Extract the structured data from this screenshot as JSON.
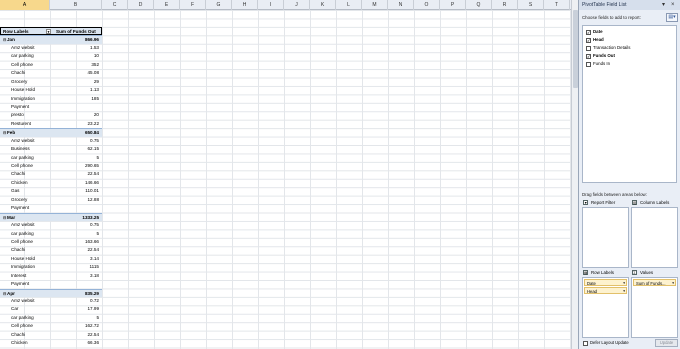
{
  "columns": [
    "A",
    "B",
    "C",
    "D",
    "E",
    "F",
    "G",
    "H",
    "I",
    "J",
    "K",
    "L",
    "M",
    "N",
    "O",
    "P",
    "Q",
    "R",
    "S",
    "T"
  ],
  "pivot": {
    "row_labels_header": "Row Labels",
    "values_header": "Sum of Funds Out",
    "rows": [
      {
        "type": "month",
        "label": "Jan",
        "value": "866.96"
      },
      {
        "type": "item",
        "label": "Amz websit",
        "value": "1.53"
      },
      {
        "type": "item",
        "label": "car parking",
        "value": "10"
      },
      {
        "type": "item",
        "label": "Cell phone",
        "value": "352"
      },
      {
        "type": "item",
        "label": "Chachi",
        "value": "45.08"
      },
      {
        "type": "item",
        "label": "Grocery",
        "value": "29"
      },
      {
        "type": "item",
        "label": "House Hold",
        "value": "1.13"
      },
      {
        "type": "item",
        "label": "Immigration",
        "value": "185"
      },
      {
        "type": "item",
        "label": "Payment",
        "value": ""
      },
      {
        "type": "item",
        "label": "presto",
        "value": "20"
      },
      {
        "type": "item",
        "label": "Resturent",
        "value": "23.22"
      },
      {
        "type": "month",
        "label": "Feb",
        "value": "650.84"
      },
      {
        "type": "item",
        "label": "Amz websit",
        "value": "0.75"
      },
      {
        "type": "item",
        "label": "Business",
        "value": "62.15"
      },
      {
        "type": "item",
        "label": "car parking",
        "value": "5"
      },
      {
        "type": "item",
        "label": "Cell phone",
        "value": "290.65"
      },
      {
        "type": "item",
        "label": "Chachi",
        "value": "22.54"
      },
      {
        "type": "item",
        "label": "Chicken",
        "value": "146.66"
      },
      {
        "type": "item",
        "label": "Gas",
        "value": "110.01"
      },
      {
        "type": "item",
        "label": "Grocery",
        "value": "12.88"
      },
      {
        "type": "item",
        "label": "Payment",
        "value": ""
      },
      {
        "type": "month",
        "label": "Mar",
        "value": "1333.25"
      },
      {
        "type": "item",
        "label": "Amz websit",
        "value": "0.75"
      },
      {
        "type": "item",
        "label": "car parking",
        "value": "5"
      },
      {
        "type": "item",
        "label": "Cell phone",
        "value": "163.66"
      },
      {
        "type": "item",
        "label": "Chachi",
        "value": "22.54"
      },
      {
        "type": "item",
        "label": "House Hold",
        "value": "3.14"
      },
      {
        "type": "item",
        "label": "Immigration",
        "value": "1115"
      },
      {
        "type": "item",
        "label": "Interest",
        "value": "3.18"
      },
      {
        "type": "item",
        "label": "Payment",
        "value": ""
      },
      {
        "type": "month",
        "label": "Apr",
        "value": "835.29"
      },
      {
        "type": "item",
        "label": "Amz websit",
        "value": "0.72"
      },
      {
        "type": "item",
        "label": "Car",
        "value": "17.99"
      },
      {
        "type": "item",
        "label": "car parking",
        "value": "5"
      },
      {
        "type": "item",
        "label": "Cell phone",
        "value": "162.72"
      },
      {
        "type": "item",
        "label": "Chachi",
        "value": "22.54"
      },
      {
        "type": "item",
        "label": "Chicken",
        "value": "66.36"
      },
      {
        "type": "item",
        "label": "cloth",
        "value": "261.76"
      }
    ]
  },
  "pane": {
    "title": "PivotTable Field List",
    "choose_label": "Choose fields to add to report:",
    "fields": [
      {
        "name": "Date",
        "checked": true
      },
      {
        "name": "Head",
        "checked": true
      },
      {
        "name": "Transaction Details",
        "checked": false
      },
      {
        "name": "Funds Out",
        "checked": true
      },
      {
        "name": "Funds In",
        "checked": false
      }
    ],
    "drag_label": "Drag fields between areas below:",
    "report_filter": "Report Filter",
    "column_labels": "Column Labels",
    "row_labels": "Row Labels",
    "values": "Values",
    "row_chips": [
      "Date",
      "Head"
    ],
    "value_chips": [
      "Sum of Funds..."
    ],
    "defer_label": "Defer Layout Update",
    "update_label": "Update"
  }
}
